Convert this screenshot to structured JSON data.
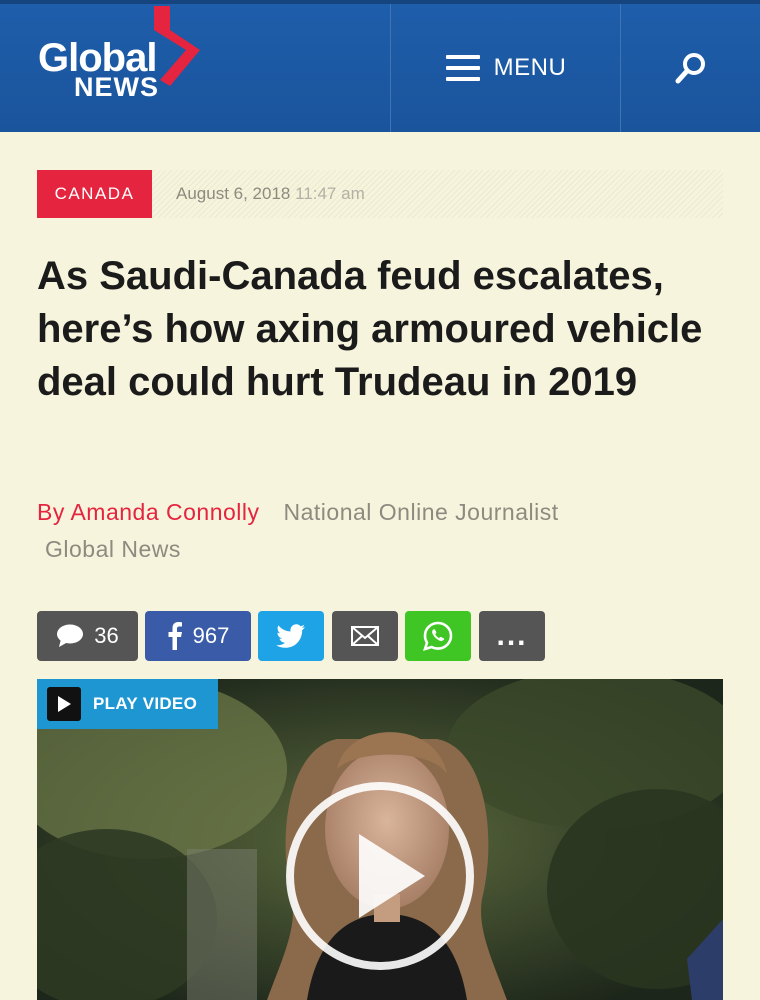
{
  "header": {
    "logo_line1": "Global",
    "logo_line2": "NEWS",
    "menu_label": "MENU",
    "brand_color": "#1d5aa6",
    "accent_color": "#e5243f",
    "search_icon": "search-icon"
  },
  "article": {
    "category": "CANADA",
    "date": "August 6, 2018",
    "time": "11:47 am",
    "headline": "As Saudi-Canada feud escalates, here’s how axing armoured vehicle deal could hurt Trudeau in 2019",
    "author": "By Amanda Connolly",
    "author_role": "National Online Journalist",
    "author_org": "Global News"
  },
  "share": {
    "comments_count": "36",
    "facebook_count": "967",
    "more_label": "..."
  },
  "video": {
    "play_label": "PLAY VIDEO"
  }
}
